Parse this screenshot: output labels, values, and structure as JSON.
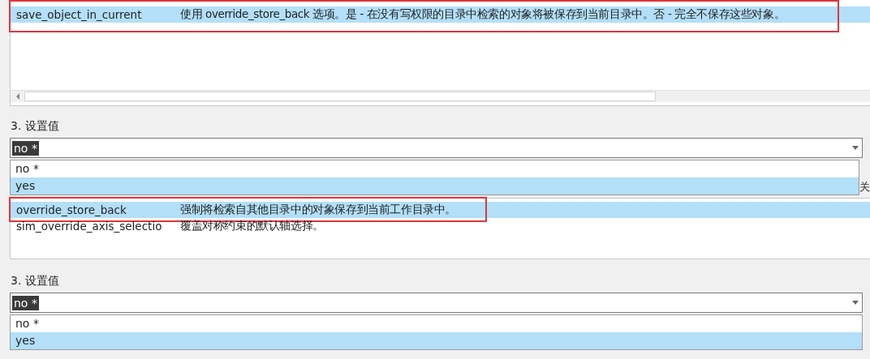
{
  "sections": [
    {
      "options_list": {
        "rows": [
          {
            "name": "save_object_in_current",
            "description": "使用 override_store_back 选项。是 - 在没有写权限的目录中检索的对象将被保存到当前目录中。否 - 完全不保存这些对象。",
            "selected": true,
            "annotated": true
          }
        ]
      },
      "value_label": "3.  设置值",
      "combo": {
        "value": "no *",
        "open": true
      },
      "dropdown": [
        {
          "label": "no *",
          "selected": false
        },
        {
          "label": "yes",
          "selected": true
        }
      ],
      "right_button": {
        "label": "关"
      }
    },
    {
      "options_list": {
        "rows": [
          {
            "name": "override_store_back",
            "description": "强制将检索自其他目录中的对象保存到当前工作目录中。",
            "selected": true,
            "annotated": true
          },
          {
            "name": "sim_override_axis_selectio",
            "description": "覆盖对称约束的默认轴选择。",
            "selected": false,
            "annotated": false
          }
        ]
      },
      "value_label": "3.  设置值",
      "combo": {
        "value": "no *",
        "open": true
      },
      "dropdown": [
        {
          "label": "no *",
          "selected": false
        },
        {
          "label": "yes",
          "selected": true
        }
      ]
    }
  ]
}
